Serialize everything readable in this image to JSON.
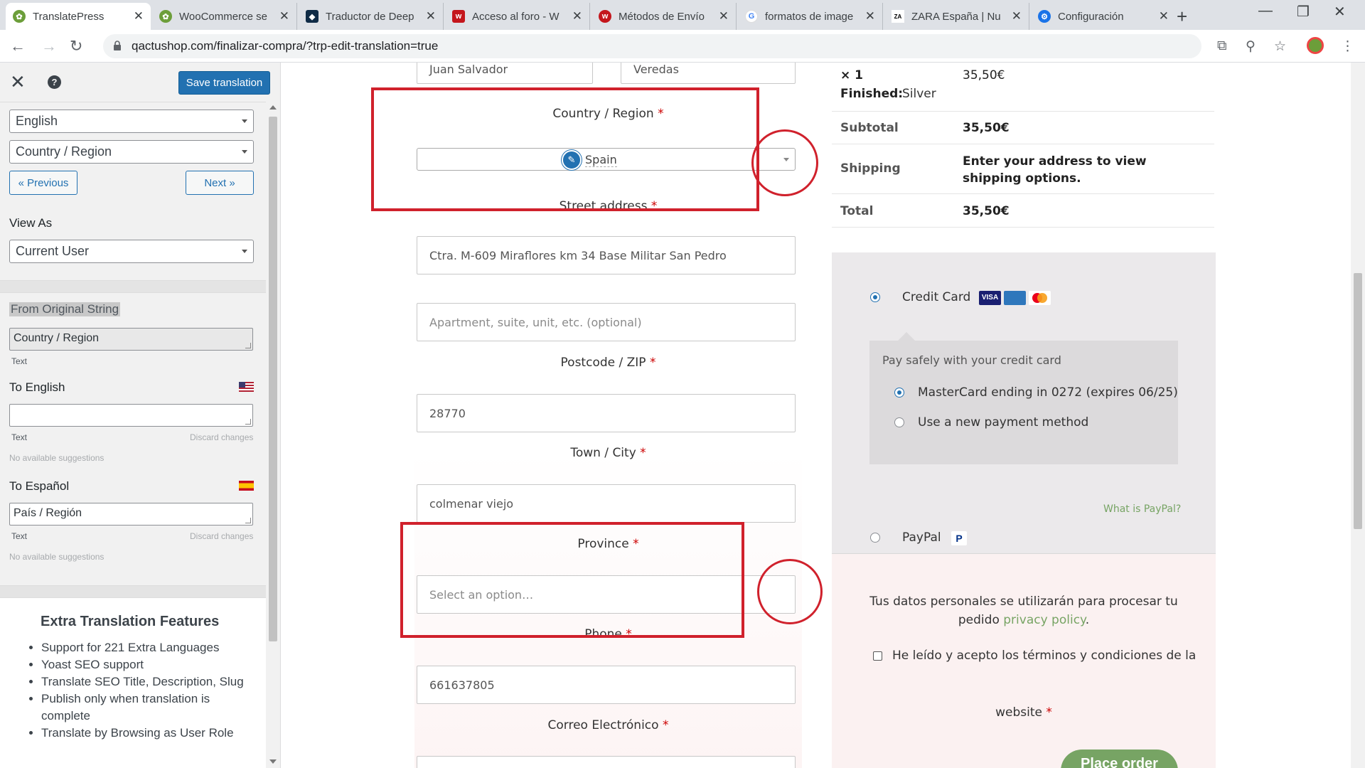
{
  "browser": {
    "tabs": [
      {
        "title": "TranslatePress",
        "favicon": "translatepress-icon",
        "color": "#6c9e3a"
      },
      {
        "title": "WooCommerce se",
        "favicon": "translatepress-icon",
        "color": "#6c9e3a"
      },
      {
        "title": "Traductor de Deep",
        "favicon": "deepl-icon",
        "color": "#0f2b46"
      },
      {
        "title": "Acceso al foro - W",
        "favicon": "w-icon",
        "color": "#c4161c"
      },
      {
        "title": "Métodos de Envío",
        "favicon": "w-icon",
        "color": "#c4161c"
      },
      {
        "title": "formatos de image",
        "favicon": "google-icon",
        "color": "#4285f4"
      },
      {
        "title": "ZARA España | Nu",
        "favicon": "zara-icon",
        "color": "#000000"
      },
      {
        "title": "Configuración",
        "favicon": "gear-icon",
        "color": "#1a73e8"
      }
    ],
    "url": "qactushop.com/finalizar-compra/?trp-edit-translation=true"
  },
  "sidebar": {
    "save_label": "Save translation",
    "language": "English",
    "string": "Country / Region",
    "prev_label": "« Previous",
    "next_label": "Next »",
    "view_as_label": "View As",
    "view_as_value": "Current User",
    "from_label": "From Original String",
    "original": "Country / Region",
    "original_type": "Text",
    "to_english_label": "To English",
    "english_value": "",
    "english_type": "Text",
    "english_discard": "Discard changes",
    "english_suggestions": "No available suggestions",
    "to_espanol_label": "To Español",
    "espanol_value": "País / Región",
    "espanol_type": "Text",
    "espanol_discard": "Discard changes",
    "espanol_suggestions": "No available suggestions",
    "extra_title": "Extra Translation Features",
    "extra_items": [
      "Support for 221 Extra Languages",
      "Yoast SEO support",
      "Translate SEO Title, Description, Slug",
      "Publish only when translation is complete",
      "Translate by Browsing as User Role"
    ]
  },
  "form": {
    "first_name": "Juan Salvador",
    "last_name": "Veredas",
    "country_label": "Country / Region",
    "country_value": "Spain",
    "street_label": "Street address",
    "street_value": "Ctra. M-609 Miraflores km 34 Base Militar San Pedro",
    "apartment_placeholder": "Apartment, suite, unit, etc. (optional)",
    "postcode_label": "Postcode / ZIP",
    "postcode_value": "28770",
    "city_label": "Town / City",
    "city_value": "colmenar viejo",
    "province_label": "Province",
    "province_placeholder": "Select an option…",
    "phone_label": "Phone",
    "phone_value": "661637805",
    "email_label": "Correo Electrónico",
    "required_mark": "*"
  },
  "summary": {
    "qty": "× 1",
    "finished_label": "Finished:",
    "finished_value": "Silver",
    "item_price": "35,50€",
    "subtotal_label": "Subtotal",
    "subtotal_value": "35,50€",
    "shipping_label": "Shipping",
    "shipping_value": "Enter your address to view shipping options.",
    "total_label": "Total",
    "total_value": "35,50€"
  },
  "payment": {
    "credit_card_label": "Credit Card",
    "pay_safely": "Pay safely with your credit card",
    "saved_card": "MasterCard ending in 0272 (expires 06/25)",
    "new_method": "Use a new payment method",
    "what_is_paypal": "What is PayPal?",
    "paypal_label": "PayPal",
    "privacy_text": "Tus datos personales se utilizarán para procesar tu pedido",
    "privacy_link": "privacy policy",
    "terms_text": "He leído y acepto los términos y condiciones de la",
    "website_label": "website",
    "place_order": "Place order"
  },
  "colors": {
    "highlight": "#d0212c",
    "accent": "#2271b1",
    "woo_green": "#77a464"
  }
}
